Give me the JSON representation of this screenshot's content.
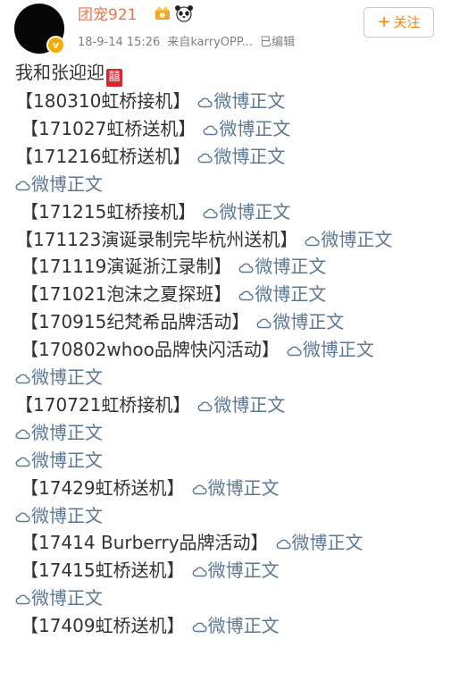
{
  "post": {
    "username": "团宠921",
    "timestamp": "18-9-14 15:26",
    "source": "来自karryOPP...",
    "edited": "已编辑",
    "follow_label": "关注",
    "intro": "我和张迎迎",
    "intro_emoji": "囍",
    "link_label": "微博正文",
    "lines": [
      {
        "text": "【180310虹桥接机】",
        "link": true
      },
      {
        "text": "【171027虹桥送机】",
        "link": true
      },
      {
        "text": "【171216虹桥送机】",
        "link": true
      },
      {
        "text": "",
        "link": true
      },
      {
        "text": "【171215虹桥接机】",
        "link": true
      },
      {
        "text": "【171123演诞录制完毕杭州送机】",
        "link": true
      },
      {
        "text": "【171119演诞浙江录制】",
        "link": true
      },
      {
        "text": "【171021泡沫之夏探班】",
        "link": true
      },
      {
        "text": "【170915纪梵希品牌活动】",
        "link": true
      },
      {
        "text": "【170802whoo品牌快闪活动】",
        "link": true
      },
      {
        "text": "",
        "link": true
      },
      {
        "text": "【170721虹桥接机】",
        "link": true
      },
      {
        "text": "",
        "link": true
      },
      {
        "text": "",
        "link": true
      },
      {
        "text": "【17429虹桥送机】",
        "link": true
      },
      {
        "text": "",
        "link": true
      },
      {
        "text": "【17414 Burberry品牌活动】",
        "link": true
      },
      {
        "text": "【17415虹桥送机】",
        "link": true
      },
      {
        "text": "",
        "link": true
      },
      {
        "text": "【17409虹桥送机】",
        "link": true
      }
    ]
  },
  "colors": {
    "username": "#eb7350",
    "link": "#5d7895",
    "follow": "#ff8200"
  }
}
